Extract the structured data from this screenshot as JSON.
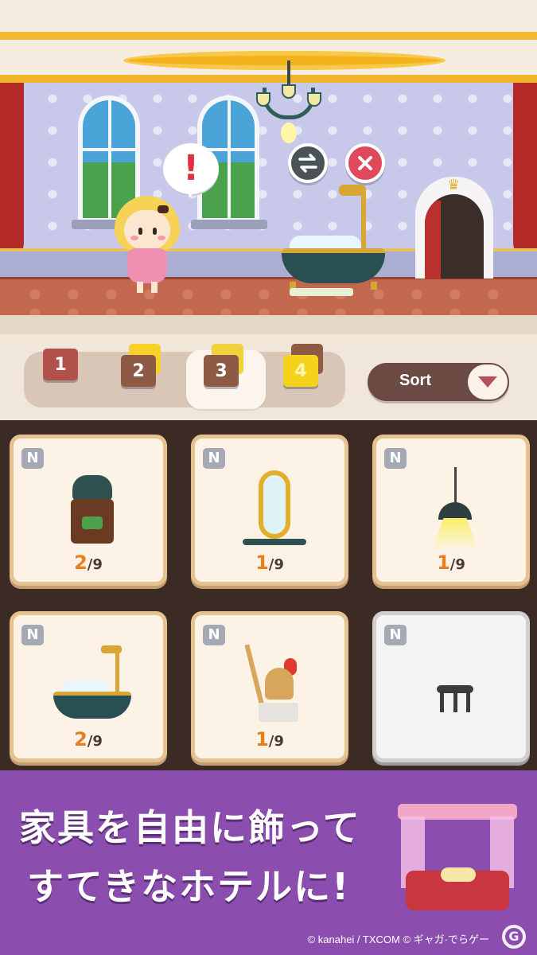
{
  "scene": {
    "speech_bubble": "!",
    "swap_icon": "swap-arrows-icon",
    "close_icon": "close-icon"
  },
  "tabs": [
    {
      "label": "1",
      "active": false
    },
    {
      "label": "2",
      "active": false
    },
    {
      "label": "3",
      "active": true
    },
    {
      "label": "4",
      "active": false
    }
  ],
  "sort": {
    "label": "Sort",
    "icon": "chevron-down-icon"
  },
  "items": [
    {
      "badge": "N",
      "owned": "2",
      "total": "/9",
      "name": "telephone-table"
    },
    {
      "badge": "N",
      "owned": "1",
      "total": "/9",
      "name": "gold-mirror"
    },
    {
      "badge": "N",
      "owned": "1",
      "total": "/9",
      "name": "pendant-lamp"
    },
    {
      "badge": "N",
      "owned": "2",
      "total": "/9",
      "name": "bathtub"
    },
    {
      "badge": "N",
      "owned": "1",
      "total": "/9",
      "name": "knight-statue"
    },
    {
      "badge": "N",
      "owned": "",
      "total": "",
      "name": "stool",
      "locked": true
    }
  ],
  "banner": {
    "line1": "家具を自由に飾って",
    "line2": "すてきなホテルに!"
  },
  "footer": {
    "copyright": "© kanahei / TXCOM   © ギャガ·でらゲー",
    "watermark": "G"
  },
  "colors": {
    "accent_orange": "#e77f1e",
    "banner_purple": "#8b4dae",
    "card_border": "#e6c291",
    "close_red": "#e0485b"
  }
}
